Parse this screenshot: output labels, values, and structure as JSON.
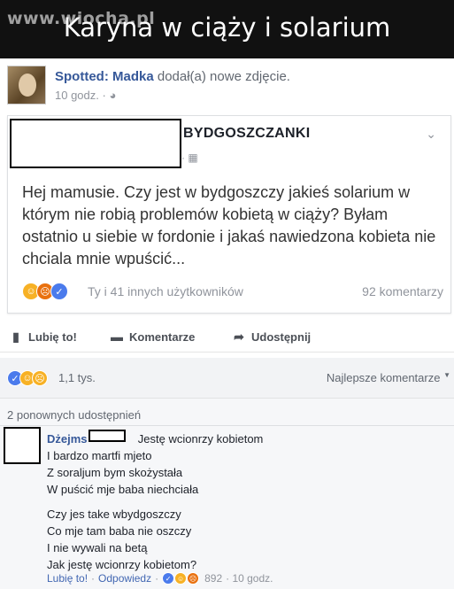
{
  "banner": {
    "watermark": "www.wiocha.pl",
    "title": "Karyna w ciąży i solarium"
  },
  "post": {
    "page_name": "Spotted: Madka",
    "action_text": "dodał(a) nowe zdjęcie.",
    "time": "10 godz. · ",
    "privacy_icon": "globe-icon"
  },
  "shared_post": {
    "group_name": "BYDGOSZCZANKI",
    "meta": "· ",
    "text": "Hej mamusie. Czy jest w bydgoszczy jakieś solarium w którym nie robią problemów kobietą w ciąży? Byłam ostatnio u siebie w fordonie i jakaś nawiedzona kobieta nie chciala mnie wpuścić...",
    "reactions_text": "Ty i 41 innych użytkowników",
    "comments_count": "92 komentarzy"
  },
  "actions": {
    "like": "Lubię to!",
    "comment": "Komentarze",
    "share": "Udostępnij"
  },
  "summary": {
    "count": "1,1 tys.",
    "sort_label": "Najlepsze komentarze"
  },
  "comments": {
    "shares_label": "2 ponownych udostępnień",
    "author": "Dżejms",
    "lines": [
      "Jestę wcionrzy kobietom",
      "I bardzo martfi mjeto",
      "Z soraljum bym skożystała",
      "W puścić mje baba niechciała",
      "Czy jes take wbydgoszczy",
      "Co mje tam baba nie oszczy",
      "I nie wywali na betą",
      "Jak jestę wcionrzy kobietom?"
    ],
    "like_label": "Lubię to!",
    "reply_label": "Odpowiedz",
    "reaction_count": "892",
    "time": "· 10 godz."
  },
  "colors": {
    "link": "#365899",
    "like": "#4b7bec",
    "haha": "#f7b125",
    "angry": "#e9710f"
  }
}
